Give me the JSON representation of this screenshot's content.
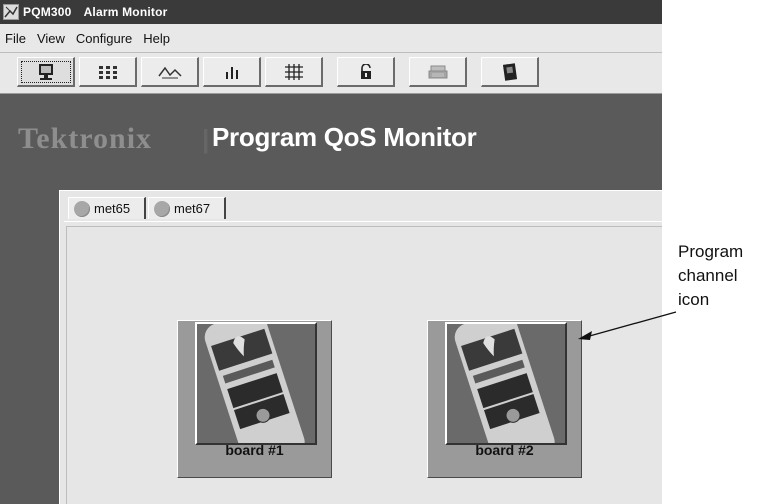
{
  "window": {
    "title": "PQM300",
    "subtitle": "Alarm Monitor"
  },
  "menu": [
    "File",
    "View",
    "Configure",
    "Help"
  ],
  "toolbar": {
    "buttons": [
      {
        "icon": "monitor-icon",
        "active": true
      },
      {
        "icon": "grid-icon",
        "active": false
      },
      {
        "icon": "waveform-icon",
        "active": false
      },
      {
        "icon": "bar-chart-icon",
        "active": false
      },
      {
        "icon": "table-icon",
        "active": false
      },
      {
        "icon": "padlock-icon",
        "active": false
      },
      {
        "icon": "printer-icon",
        "active": false
      },
      {
        "icon": "book-icon",
        "active": false
      }
    ]
  },
  "brand": {
    "company": "Tektronix",
    "product": "Program QoS Monitor"
  },
  "tabs": [
    {
      "label": "met65"
    },
    {
      "label": "met67"
    }
  ],
  "channels": [
    {
      "label": "board #1"
    },
    {
      "label": "board #2"
    }
  ],
  "callout": {
    "line1": "Program",
    "line2": "channel",
    "line3": "icon"
  }
}
